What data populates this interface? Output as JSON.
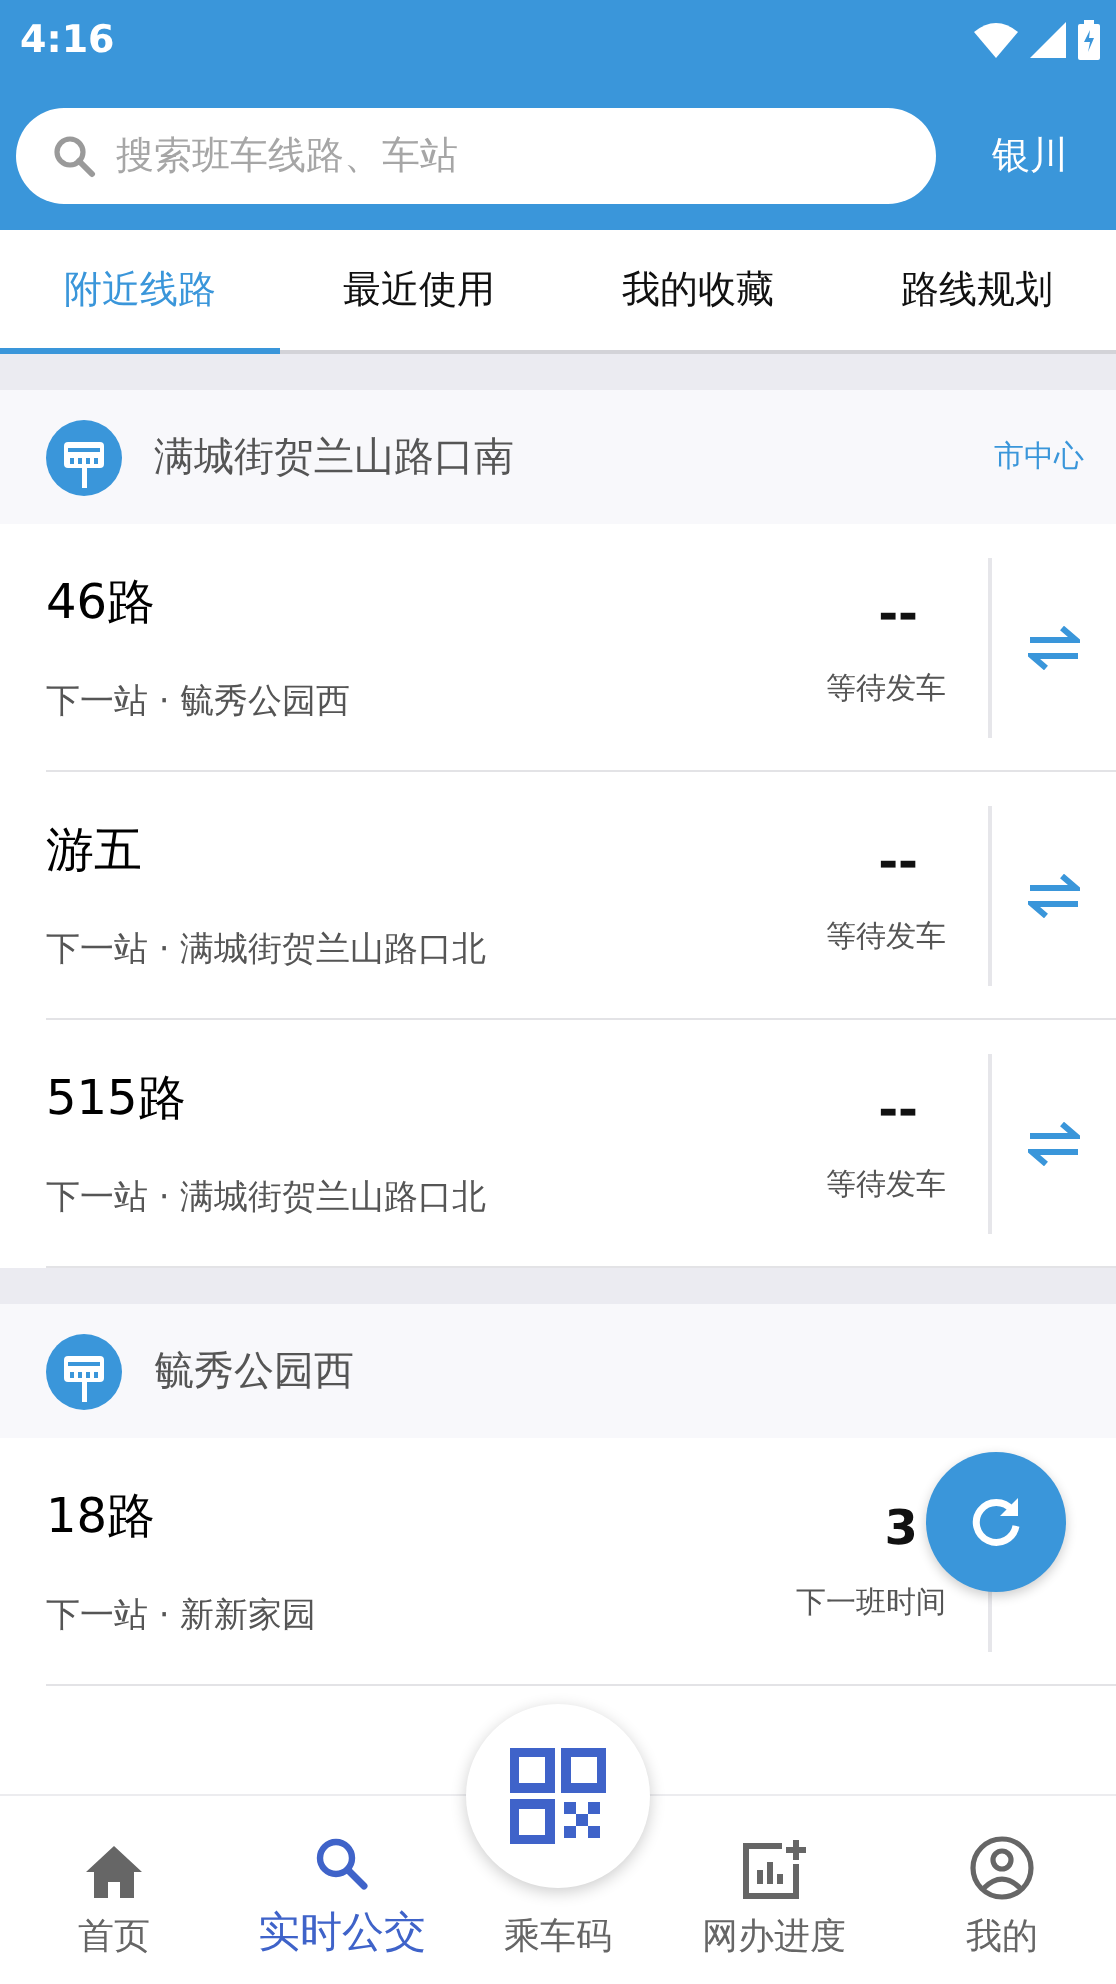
{
  "status_bar": {
    "time": "4:16"
  },
  "search": {
    "placeholder": "搜索班车线路、车站",
    "city": "银川"
  },
  "tabs": [
    {
      "label": "附近线路",
      "selected": true
    },
    {
      "label": "最近使用",
      "selected": false
    },
    {
      "label": "我的收藏",
      "selected": false
    },
    {
      "label": "路线规划",
      "selected": false
    }
  ],
  "stations": [
    {
      "name": "满城街贺兰山路口南",
      "tag": "市中心",
      "routes": [
        {
          "name": "46路",
          "next_stop": "下一站 · 毓秀公园西",
          "time": "--",
          "status": "等待发车"
        },
        {
          "name": "游五",
          "next_stop": "下一站 · 满城街贺兰山路口北",
          "time": "--",
          "status": "等待发车"
        },
        {
          "name": "515路",
          "next_stop": "下一站 · 满城街贺兰山路口北",
          "time": "--",
          "status": "等待发车"
        }
      ]
    },
    {
      "name": "毓秀公园西",
      "routes": [
        {
          "name": "18路",
          "next_stop": "下一站 · 新新家园",
          "time": "3",
          "status": "下一班时间"
        }
      ]
    }
  ],
  "bottom_nav": [
    {
      "label": "首页",
      "kind": "home",
      "selected": false
    },
    {
      "label": "实时公交",
      "kind": "search",
      "selected": true
    },
    {
      "label": "乘车码",
      "kind": "qr",
      "selected": false
    },
    {
      "label": "网办进度",
      "kind": "progress",
      "selected": false
    },
    {
      "label": "我的",
      "kind": "profile",
      "selected": false
    }
  ]
}
